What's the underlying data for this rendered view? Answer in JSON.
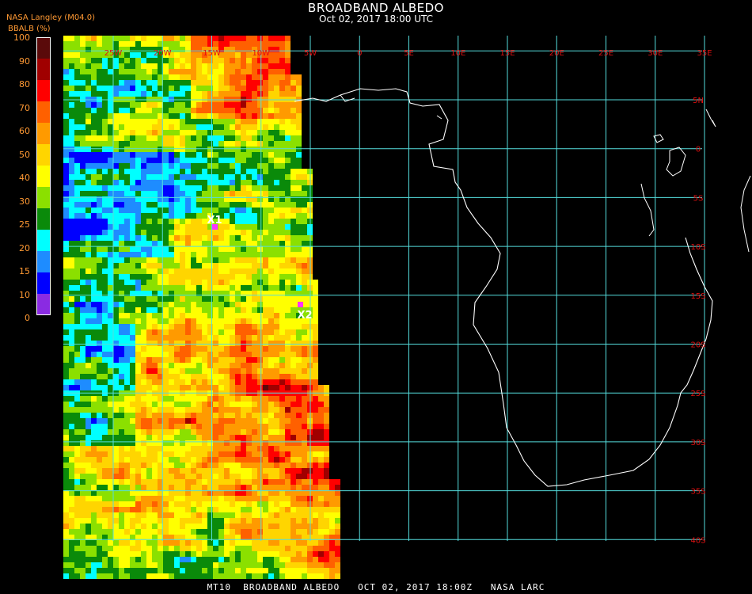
{
  "header": {
    "title": "BROADBAND ALBEDO",
    "subtitle": "Oct 02, 2017 18:00 UTC",
    "source": "NASA Langley (M04.0)",
    "variable": "BBALB (%)"
  },
  "legend": {
    "ticks": [
      "100",
      "90",
      "80",
      "70",
      "60",
      "50",
      "40",
      "30",
      "25",
      "20",
      "15",
      "10",
      "0"
    ],
    "colors": [
      "#5a0a0a",
      "#a00000",
      "#ff0000",
      "#ff6000",
      "#ff9a00",
      "#ffd500",
      "#ffff00",
      "#8be000",
      "#0a8a0a",
      "#00ffff",
      "#1e8cff",
      "#0000ff",
      "#8a2be2"
    ]
  },
  "map": {
    "lon_labels": [
      "25W",
      "20W",
      "15W",
      "10W",
      "5W",
      "0",
      "5E",
      "10E",
      "15E",
      "20E",
      "25E",
      "30E",
      "35E"
    ],
    "lat_labels": [
      "5N",
      "0",
      "5S",
      "10S",
      "15S",
      "20S",
      "25S",
      "30S",
      "35S",
      "40S"
    ],
    "markers": [
      {
        "label": "X1",
        "color": "#ff33ff"
      },
      {
        "label": "X2",
        "color": "#ff33ff"
      }
    ],
    "grid_color": "#55dddd",
    "coast_color": "#ffffff"
  },
  "footer": "MT10  BROADBAND ALBEDO   OCT 02, 2017 18:00Z   NASA LARC"
}
